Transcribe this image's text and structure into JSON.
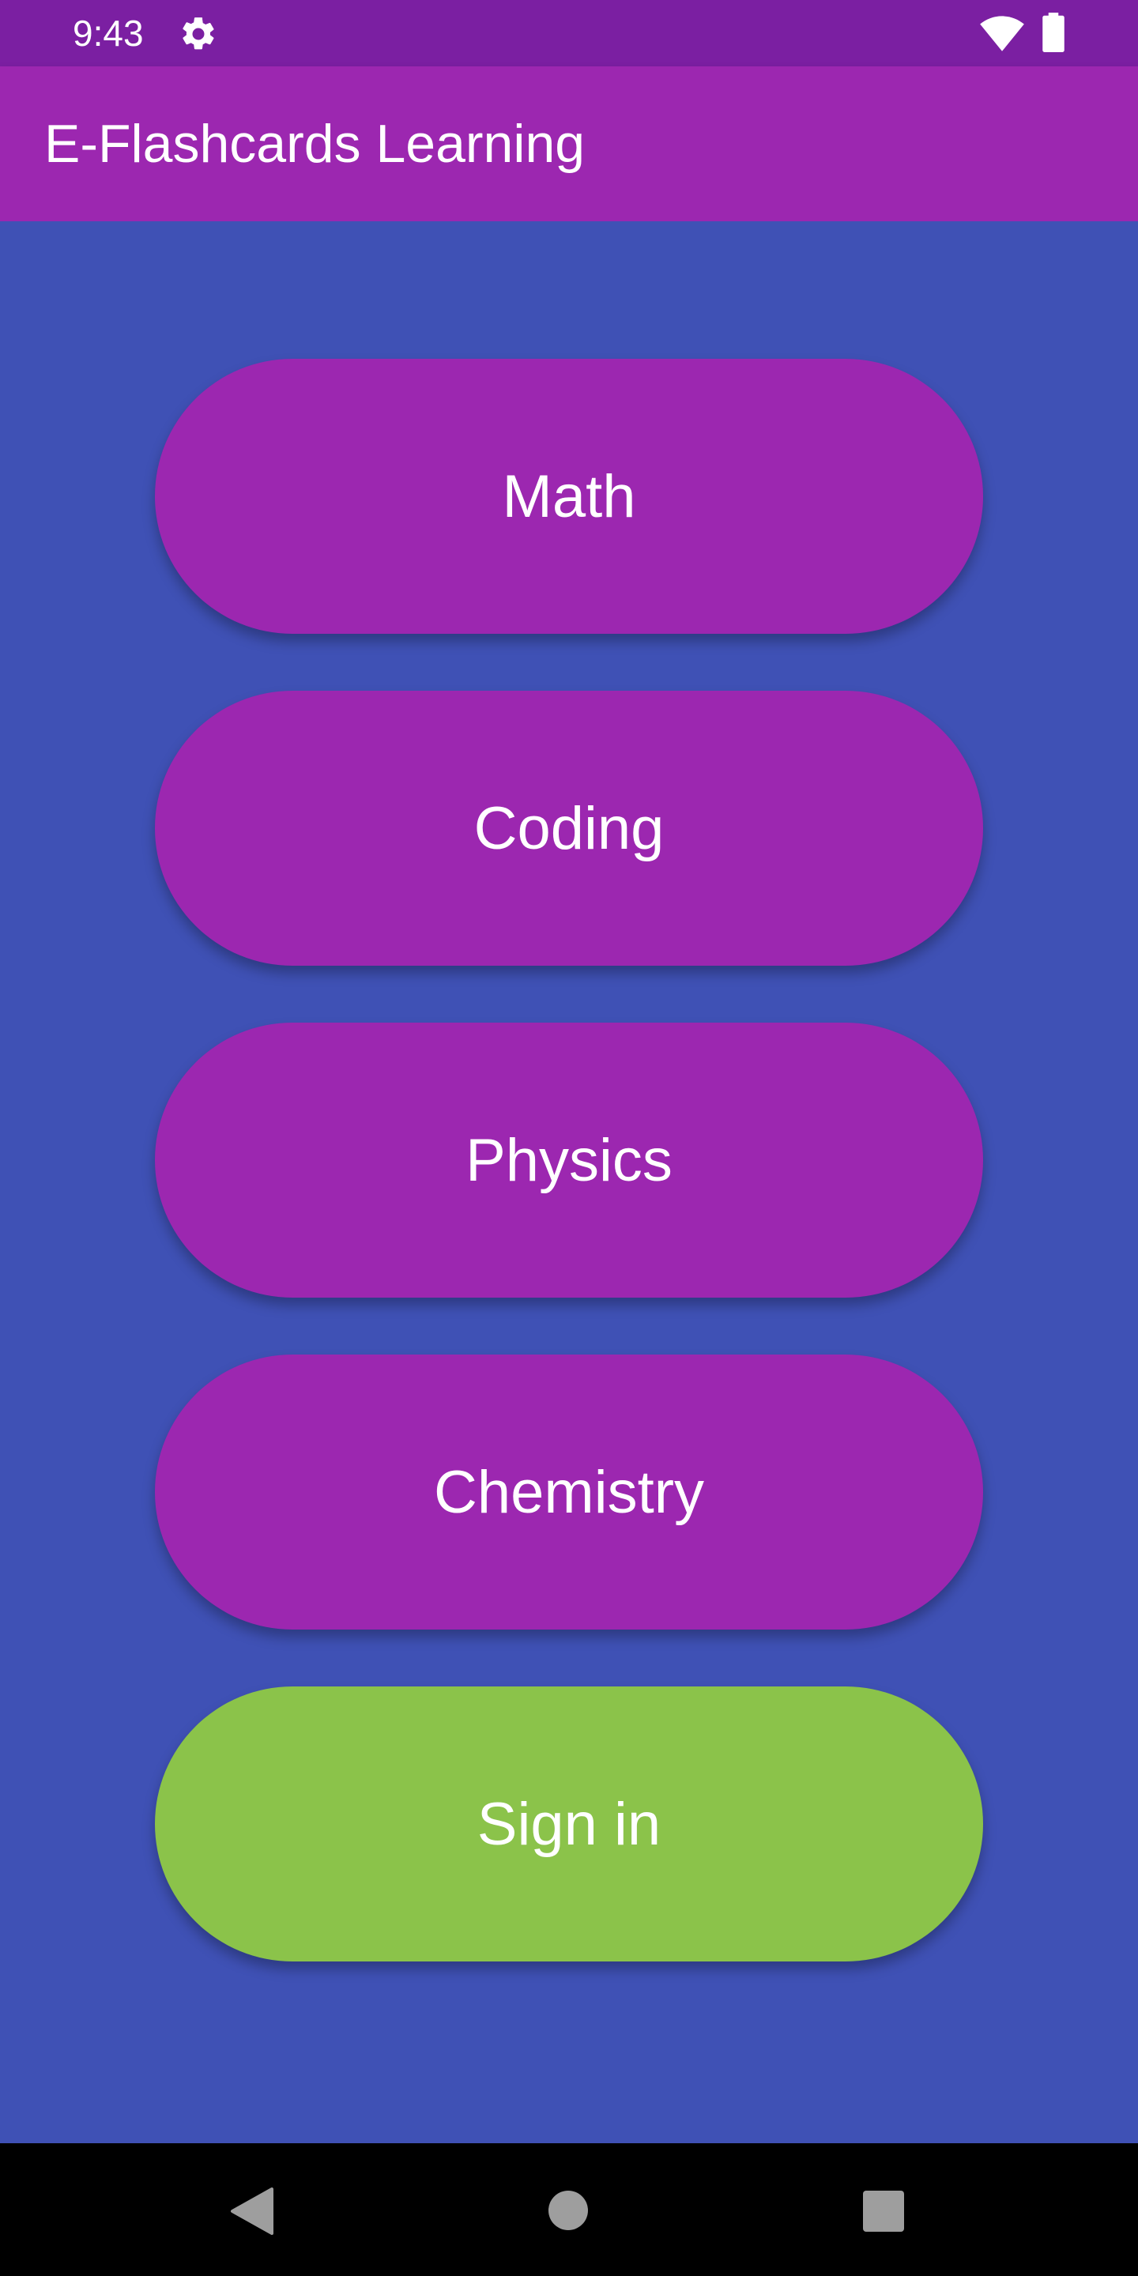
{
  "status_bar": {
    "time": "9:43",
    "icons": [
      "settings-gear-icon",
      "wifi-icon",
      "battery-icon"
    ],
    "background": "#7B1FA2"
  },
  "app_bar": {
    "title": "E-Flashcards Learning",
    "background": "#9C27B0"
  },
  "content": {
    "background": "#3F51B5",
    "buttons": [
      {
        "label": "Math",
        "color": "#9C27B0"
      },
      {
        "label": "Coding",
        "color": "#9C27B0"
      },
      {
        "label": "Physics",
        "color": "#9C27B0"
      },
      {
        "label": "Chemistry",
        "color": "#9C27B0"
      },
      {
        "label": "Sign in",
        "color": "#8BC34A"
      }
    ]
  },
  "nav_bar": {
    "icons": [
      "back-icon",
      "home-icon",
      "recents-icon"
    ],
    "background": "#000000"
  }
}
